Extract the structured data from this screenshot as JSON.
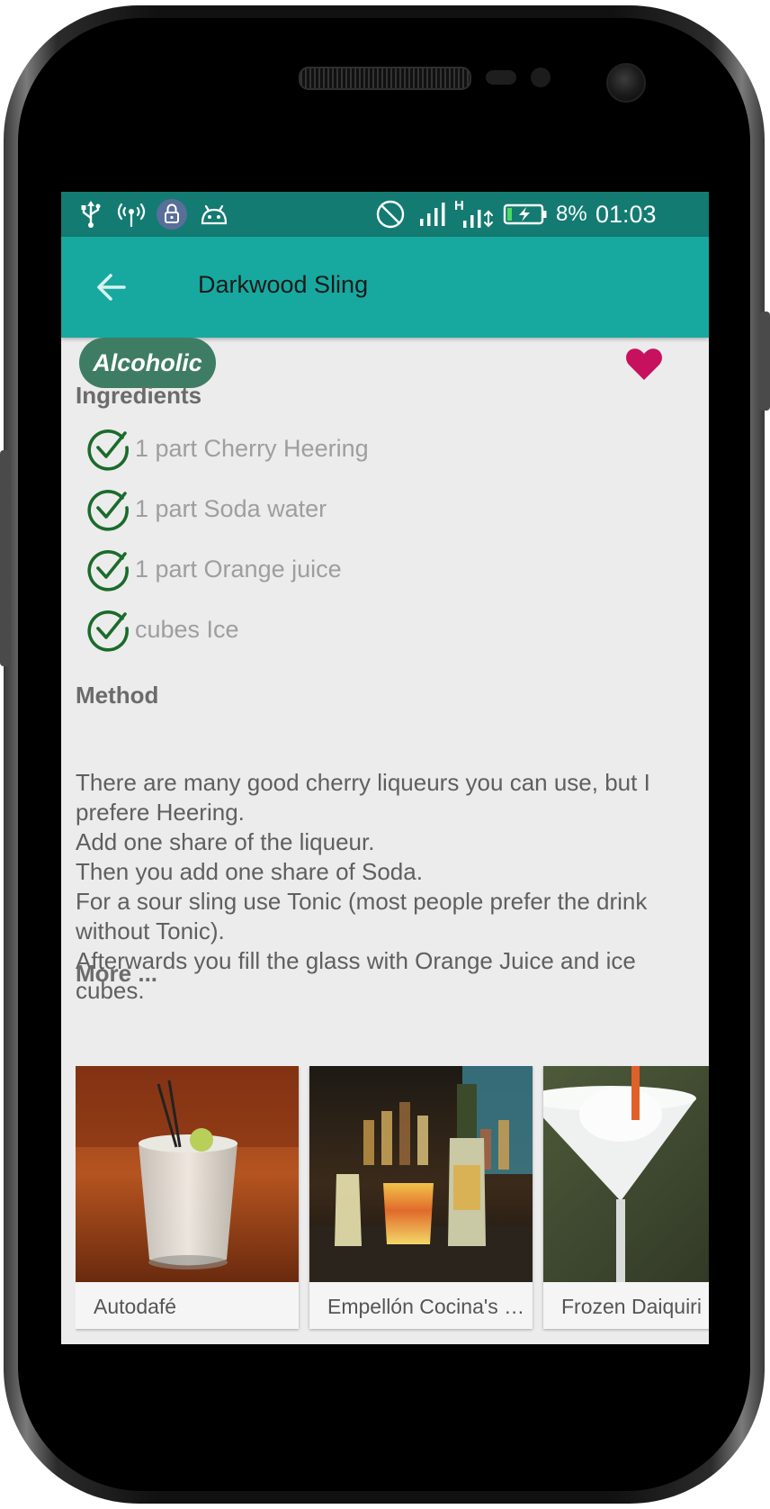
{
  "status_bar": {
    "battery": "8%",
    "time": "01:03",
    "network_type": "H",
    "icons": [
      "usb-icon",
      "hotspot-icon",
      "vpn-lock-icon",
      "android-debug-icon",
      "do-not-disturb-icon",
      "signal-icon",
      "data-arrows-icon",
      "battery-charging-icon"
    ]
  },
  "app_bar": {
    "back_icon": "arrow-back-icon",
    "title": "Darkwood Sling"
  },
  "category_chip": "Alcoholic",
  "favorite": {
    "icon": "heart-icon",
    "color": "#c8115e",
    "active": true
  },
  "ingredients": {
    "title": "Ingredients",
    "items": [
      {
        "text": "1 part Cherry Heering",
        "checked": true
      },
      {
        "text": "1 part Soda water",
        "checked": true
      },
      {
        "text": "1 part Orange juice",
        "checked": true
      },
      {
        "text": "cubes Ice",
        "checked": true
      }
    ]
  },
  "method": {
    "title": "Method",
    "text": "There are many good cherry liqueurs you can use, but I prefere Heering.\nAdd one share of the liqueur.\nThen you add one share of Soda.\nFor a sour sling use Tonic (most people prefer the drink without Tonic).\nAfterwards you fill the glass with Orange Juice and ice cubes."
  },
  "more": {
    "title": "More ...",
    "cards": [
      {
        "label": "Autodafé"
      },
      {
        "label": "Empellón Cocina's Fat-Washed Mezcal"
      },
      {
        "label": "Frozen Daiquiri"
      }
    ]
  },
  "colors": {
    "status_bar": "#137b72",
    "app_bar": "#17a99f",
    "chip": "#3e7d64",
    "check": "#1b6b2b",
    "screen_bg": "#ececec"
  }
}
